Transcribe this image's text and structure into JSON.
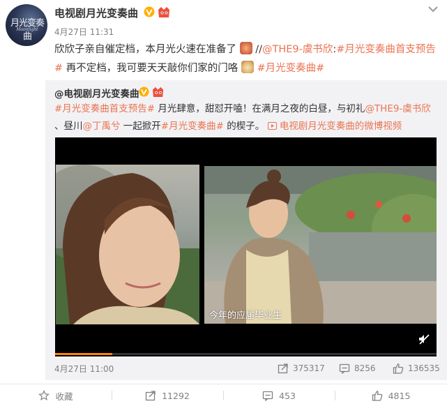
{
  "account": {
    "name": "电视剧月光变奏曲",
    "avatar_text": "月光变奏曲",
    "avatar_subtext": "Moonlight",
    "time": "4月27日 11:31"
  },
  "post": {
    "text_1": "欣欣子亲自催定档，本月光火速在准备了",
    "text_2": "//",
    "mention_1": "@THE9-虞书欣",
    "text_3": ":",
    "hashtag_1": "#月光变奏曲首支预告#",
    "text_4": " 再不定档，我可要天天敲你们家的门咯",
    "hashtag_2": "#月光变奏曲#"
  },
  "repost": {
    "author": "@电视剧月光变奏曲",
    "hashtag_1": "#月光变奏曲首支预告#",
    "text_1": " 月光肆意，甜怼开嗑！在满月之夜的白昼，与初礼",
    "mention_1": "@THE9-虞书欣",
    "text_2": " 、昼川",
    "mention_2": "@丁禹兮",
    "text_3": " 一起掀开",
    "hashtag_2": "#月光变奏曲#",
    "text_4": " 的楔子。",
    "video_link": "电视剧月光变奏曲的微博视频",
    "video_caption": "今年的应届毕业生",
    "video_progress": 0.15,
    "time": "4月27日 11:00",
    "reposts": "375317",
    "comments": "8256",
    "likes": "136535"
  },
  "actions": {
    "favorite": "收藏",
    "repost": "11292",
    "comment": "453",
    "like": "4815"
  },
  "colors": {
    "link": "#eb7350",
    "verified": "#ffb000",
    "progress": "#ff8200"
  }
}
